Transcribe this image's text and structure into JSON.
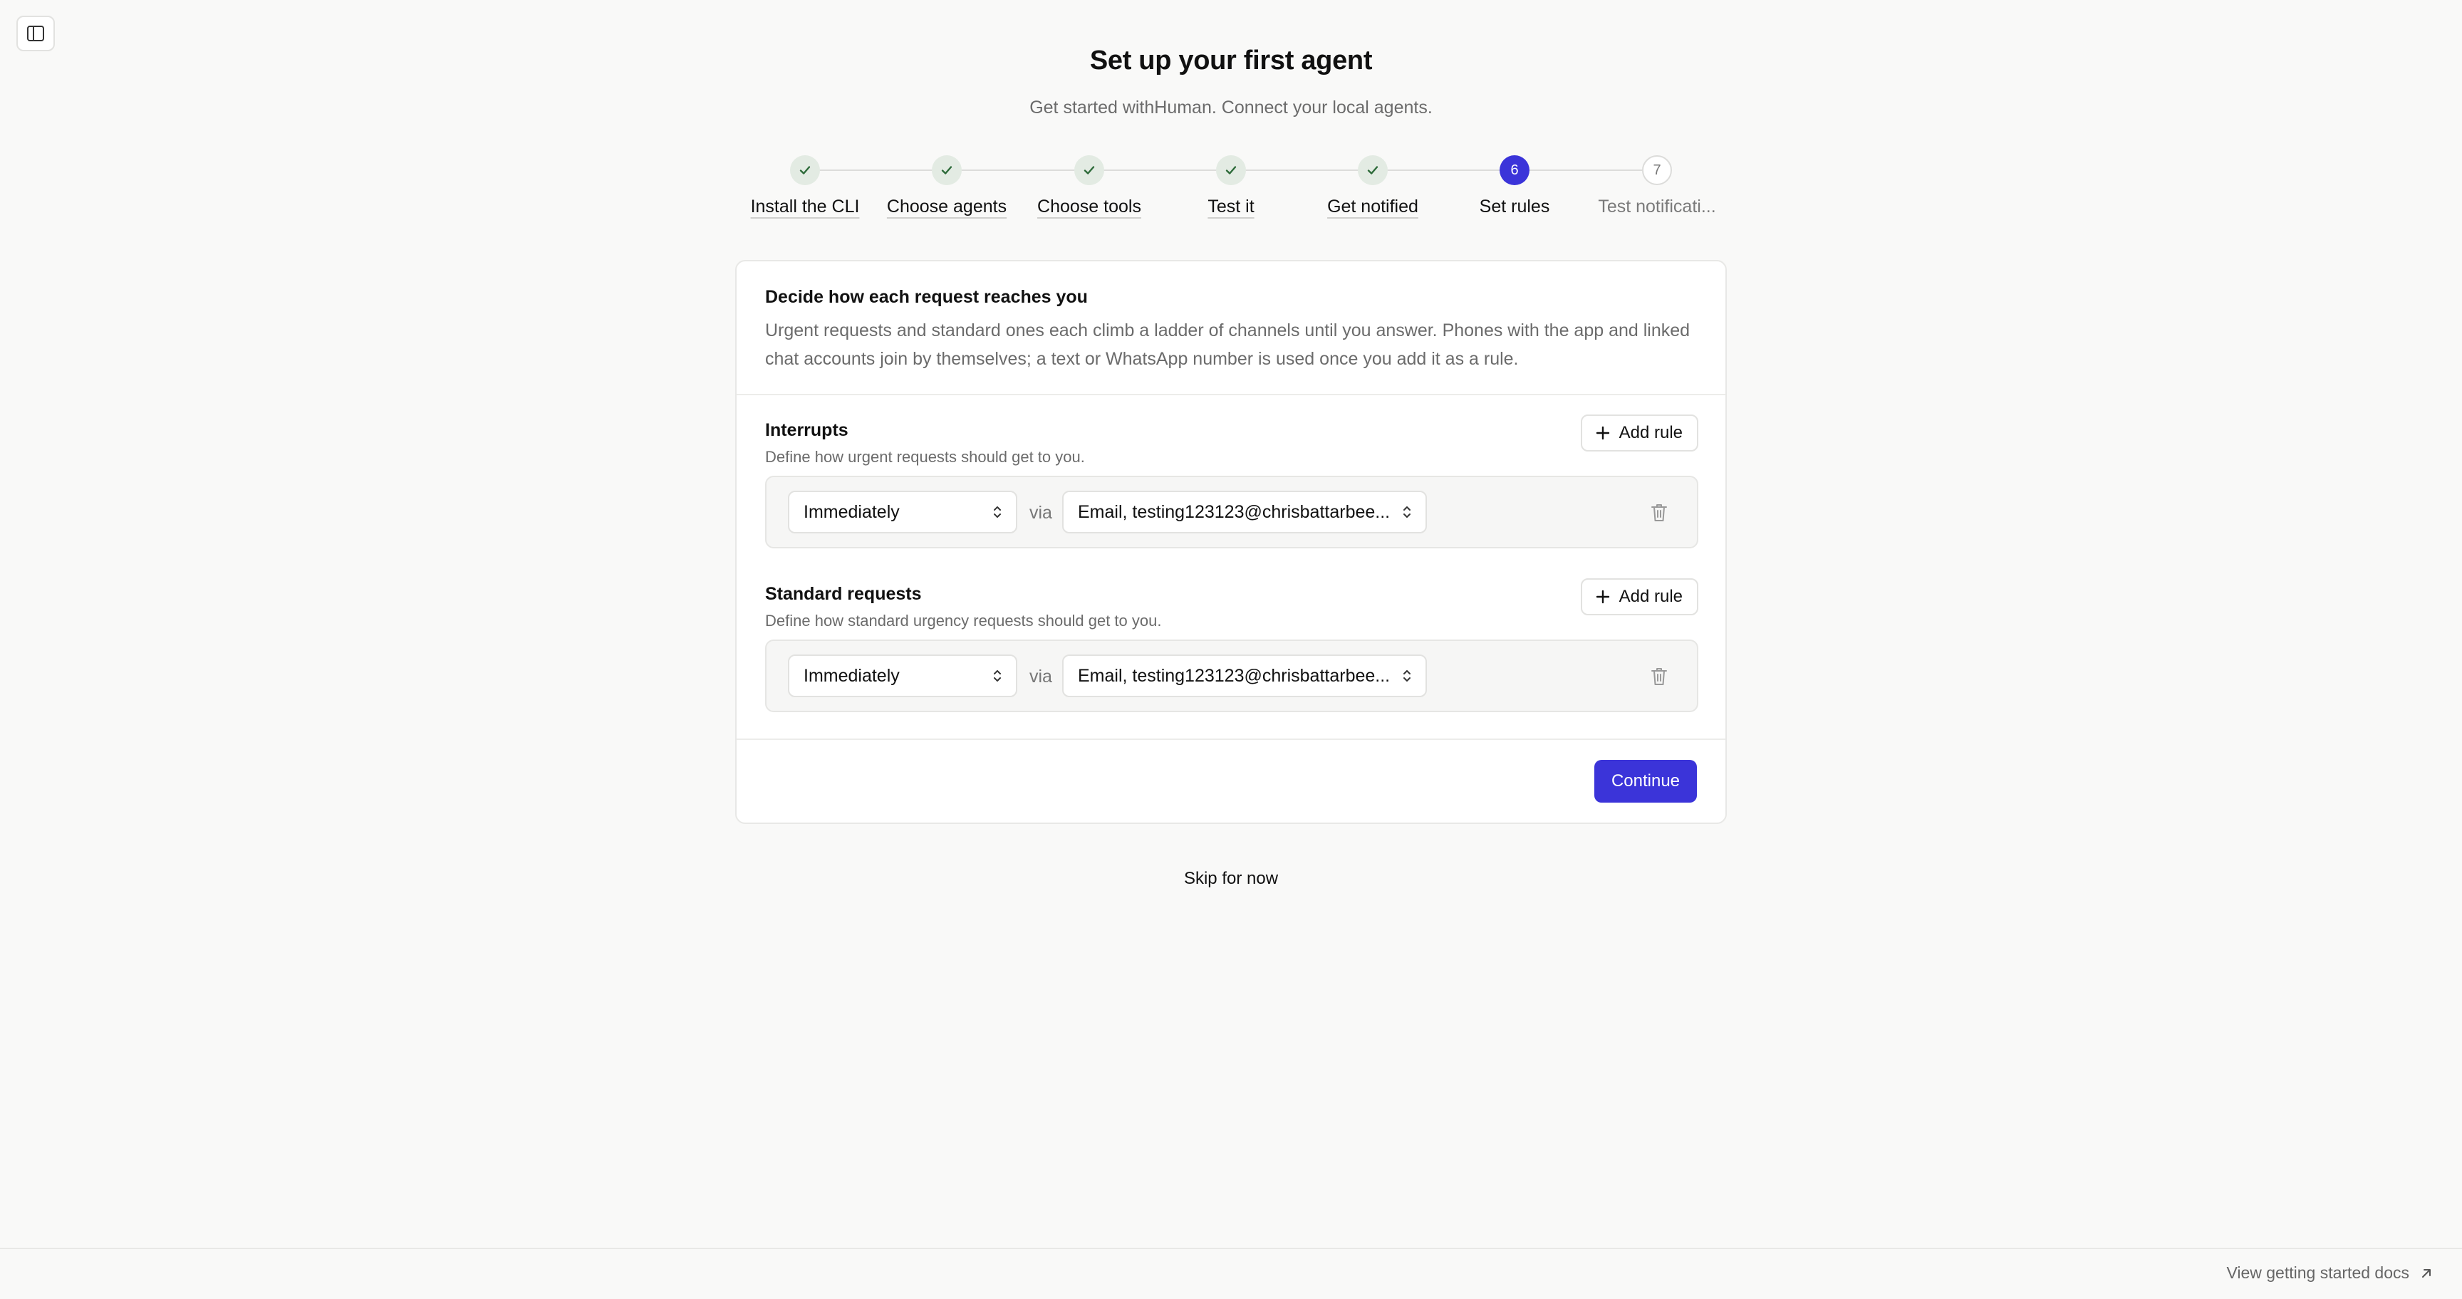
{
  "header": {
    "title": "Set up your first agent",
    "subtitle": "Get started withHuman. Connect your local agents."
  },
  "steps": [
    {
      "label": "Install the CLI",
      "status": "done",
      "marker": "check-icon"
    },
    {
      "label": "Choose agents",
      "status": "done",
      "marker": "check-icon"
    },
    {
      "label": "Choose tools",
      "status": "done",
      "marker": "check-icon"
    },
    {
      "label": "Test it",
      "status": "done",
      "marker": "check-icon"
    },
    {
      "label": "Get notified",
      "status": "done",
      "marker": "check-icon"
    },
    {
      "label": "Set rules",
      "status": "active",
      "number": "6"
    },
    {
      "label": "Test notificati...",
      "status": "todo",
      "number": "7"
    }
  ],
  "card": {
    "heading": "Decide how each request reaches you",
    "description": "Urgent requests and standard ones each climb a ladder of channels until you answer. Phones with the app and linked chat accounts join by themselves; a text or WhatsApp number is used once you add it as a rule."
  },
  "interrupts": {
    "title": "Interrupts",
    "description": "Define how urgent requests should get to you.",
    "add_label": "Add rule",
    "rule": {
      "when": "Immediately",
      "via": "via",
      "channel": "Email, testing123123@chrisbattarbee..."
    }
  },
  "standard": {
    "title": "Standard requests",
    "description": "Define how standard urgency requests should get to you.",
    "add_label": "Add rule",
    "rule": {
      "when": "Immediately",
      "via": "via",
      "channel": "Email, testing123123@chrisbattarbee..."
    }
  },
  "footer": {
    "continue_label": "Continue"
  },
  "skip_label": "Skip for now",
  "docs_label": "View getting started docs",
  "colors": {
    "accent": "#3b34d9",
    "page_bg": "#f9f9f8",
    "done_step_bg": "#e3ebe3",
    "check": "#2e6b3a"
  }
}
